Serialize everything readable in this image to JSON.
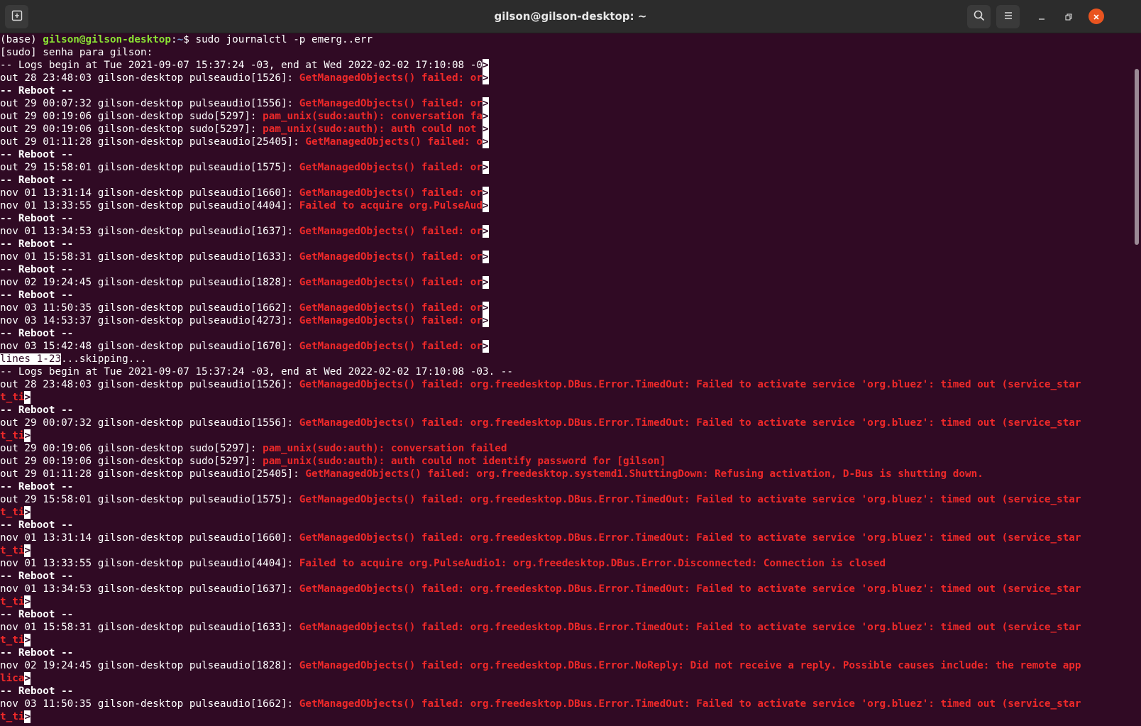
{
  "window": {
    "title": "gilson@gilson-desktop: ~",
    "icons": {
      "new_tab": "new-tab-icon",
      "search": "search-icon",
      "menu": "hamburger-menu-icon",
      "minimize": "minimize-icon",
      "maximize": "maximize-icon",
      "close": "close-icon"
    },
    "colors": {
      "background": "#300a24",
      "error": "#ef2929",
      "user": "#8ae234",
      "dir": "#729fcf",
      "close": "#e95420"
    }
  },
  "prompt": {
    "env": "(base) ",
    "user_host": "gilson@gilson-desktop",
    "sep": ":",
    "dir": "~",
    "symbol": "$ ",
    "command": "sudo journalctl -p emerg..err"
  },
  "lines": [
    {
      "t": "plain",
      "text": "[sudo] senha para gilson:"
    },
    {
      "t": "plain",
      "text": "-- Logs begin at Tue 2021-09-07 15:37:24 -03, end at Wed 2022-02-02 17:10:08 -0",
      "trunc": ">"
    },
    {
      "t": "log",
      "prefix": "out 28 23:48:03 gilson-desktop pulseaudio[1526]: ",
      "msg": "GetManagedObjects() failed: or",
      "trunc": ">"
    },
    {
      "t": "reboot",
      "text": "-- Reboot --"
    },
    {
      "t": "log",
      "prefix": "out 29 00:07:32 gilson-desktop pulseaudio[1556]: ",
      "msg": "GetManagedObjects() failed: or",
      "trunc": ">"
    },
    {
      "t": "log",
      "prefix": "out 29 00:19:06 gilson-desktop sudo[5297]: ",
      "msg": "pam_unix(sudo:auth): conversation fa",
      "trunc": ">"
    },
    {
      "t": "log",
      "prefix": "out 29 00:19:06 gilson-desktop sudo[5297]: ",
      "msg": "pam_unix(sudo:auth): auth could not ",
      "trunc": ">"
    },
    {
      "t": "log",
      "prefix": "out 29 01:11:28 gilson-desktop pulseaudio[25405]: ",
      "msg": "GetManagedObjects() failed: o",
      "trunc": ">"
    },
    {
      "t": "reboot",
      "text": "-- Reboot --"
    },
    {
      "t": "log",
      "prefix": "out 29 15:58:01 gilson-desktop pulseaudio[1575]: ",
      "msg": "GetManagedObjects() failed: or",
      "trunc": ">"
    },
    {
      "t": "reboot",
      "text": "-- Reboot --"
    },
    {
      "t": "log",
      "prefix": "nov 01 13:31:14 gilson-desktop pulseaudio[1660]: ",
      "msg": "GetManagedObjects() failed: or",
      "trunc": ">"
    },
    {
      "t": "log",
      "prefix": "nov 01 13:33:55 gilson-desktop pulseaudio[4404]: ",
      "msg": "Failed to acquire org.PulseAud",
      "trunc": ">"
    },
    {
      "t": "reboot",
      "text": "-- Reboot --"
    },
    {
      "t": "log",
      "prefix": "nov 01 13:34:53 gilson-desktop pulseaudio[1637]: ",
      "msg": "GetManagedObjects() failed: or",
      "trunc": ">"
    },
    {
      "t": "reboot",
      "text": "-- Reboot --"
    },
    {
      "t": "log",
      "prefix": "nov 01 15:58:31 gilson-desktop pulseaudio[1633]: ",
      "msg": "GetManagedObjects() failed: or",
      "trunc": ">"
    },
    {
      "t": "reboot",
      "text": "-- Reboot --"
    },
    {
      "t": "log",
      "prefix": "nov 02 19:24:45 gilson-desktop pulseaudio[1828]: ",
      "msg": "GetManagedObjects() failed: or",
      "trunc": ">"
    },
    {
      "t": "reboot",
      "text": "-- Reboot --"
    },
    {
      "t": "log",
      "prefix": "nov 03 11:50:35 gilson-desktop pulseaudio[1662]: ",
      "msg": "GetManagedObjects() failed: or",
      "trunc": ">"
    },
    {
      "t": "log",
      "prefix": "nov 03 14:53:37 gilson-desktop pulseaudio[4273]: ",
      "msg": "GetManagedObjects() failed: or",
      "trunc": ">"
    },
    {
      "t": "reboot",
      "text": "-- Reboot --"
    },
    {
      "t": "log",
      "prefix": "nov 03 15:42:48 gilson-desktop pulseaudio[1670]: ",
      "msg": "GetManagedObjects() failed: or",
      "trunc": ">"
    },
    {
      "t": "status",
      "highlight": "lines 1-23",
      "text": "...skipping..."
    },
    {
      "t": "plain",
      "text": "-- Logs begin at Tue 2021-09-07 15:37:24 -03, end at Wed 2022-02-02 17:10:08 -03. --"
    },
    {
      "t": "log",
      "prefix": "out 28 23:48:03 gilson-desktop pulseaudio[1526]: ",
      "msg": "GetManagedObjects() failed: org.freedesktop.DBus.Error.TimedOut: Failed to activate service 'org.bluez': timed out (service_star"
    },
    {
      "t": "cont",
      "msg": "t_ti",
      "trunc": ">"
    },
    {
      "t": "reboot",
      "text": "-- Reboot --"
    },
    {
      "t": "log",
      "prefix": "out 29 00:07:32 gilson-desktop pulseaudio[1556]: ",
      "msg": "GetManagedObjects() failed: org.freedesktop.DBus.Error.TimedOut: Failed to activate service 'org.bluez': timed out (service_star"
    },
    {
      "t": "cont",
      "msg": "t_ti",
      "trunc": ">"
    },
    {
      "t": "log",
      "prefix": "out 29 00:19:06 gilson-desktop sudo[5297]: ",
      "msg": "pam_unix(sudo:auth): conversation failed"
    },
    {
      "t": "log",
      "prefix": "out 29 00:19:06 gilson-desktop sudo[5297]: ",
      "msg": "pam_unix(sudo:auth): auth could not identify password for [gilson]"
    },
    {
      "t": "log",
      "prefix": "out 29 01:11:28 gilson-desktop pulseaudio[25405]: ",
      "msg": "GetManagedObjects() failed: org.freedesktop.systemd1.ShuttingDown: Refusing activation, D-Bus is shutting down."
    },
    {
      "t": "reboot",
      "text": "-- Reboot --"
    },
    {
      "t": "log",
      "prefix": "out 29 15:58:01 gilson-desktop pulseaudio[1575]: ",
      "msg": "GetManagedObjects() failed: org.freedesktop.DBus.Error.TimedOut: Failed to activate service 'org.bluez': timed out (service_star"
    },
    {
      "t": "cont",
      "msg": "t_ti",
      "trunc": ">"
    },
    {
      "t": "reboot",
      "text": "-- Reboot --"
    },
    {
      "t": "log",
      "prefix": "nov 01 13:31:14 gilson-desktop pulseaudio[1660]: ",
      "msg": "GetManagedObjects() failed: org.freedesktop.DBus.Error.TimedOut: Failed to activate service 'org.bluez': timed out (service_star"
    },
    {
      "t": "cont",
      "msg": "t_ti",
      "trunc": ">"
    },
    {
      "t": "log",
      "prefix": "nov 01 13:33:55 gilson-desktop pulseaudio[4404]: ",
      "msg": "Failed to acquire org.PulseAudio1: org.freedesktop.DBus.Error.Disconnected: Connection is closed"
    },
    {
      "t": "reboot",
      "text": "-- Reboot --"
    },
    {
      "t": "log",
      "prefix": "nov 01 13:34:53 gilson-desktop pulseaudio[1637]: ",
      "msg": "GetManagedObjects() failed: org.freedesktop.DBus.Error.TimedOut: Failed to activate service 'org.bluez': timed out (service_star"
    },
    {
      "t": "cont",
      "msg": "t_ti",
      "trunc": ">"
    },
    {
      "t": "reboot",
      "text": "-- Reboot --"
    },
    {
      "t": "log",
      "prefix": "nov 01 15:58:31 gilson-desktop pulseaudio[1633]: ",
      "msg": "GetManagedObjects() failed: org.freedesktop.DBus.Error.TimedOut: Failed to activate service 'org.bluez': timed out (service_star"
    },
    {
      "t": "cont",
      "msg": "t_ti",
      "trunc": ">"
    },
    {
      "t": "reboot",
      "text": "-- Reboot --"
    },
    {
      "t": "log",
      "prefix": "nov 02 19:24:45 gilson-desktop pulseaudio[1828]: ",
      "msg": "GetManagedObjects() failed: org.freedesktop.DBus.Error.NoReply: Did not receive a reply. Possible causes include: the remote app"
    },
    {
      "t": "cont",
      "msg": "lica",
      "trunc": ">"
    },
    {
      "t": "reboot",
      "text": "-- Reboot --"
    },
    {
      "t": "log",
      "prefix": "nov 03 11:50:35 gilson-desktop pulseaudio[1662]: ",
      "msg": "GetManagedObjects() failed: org.freedesktop.DBus.Error.TimedOut: Failed to activate service 'org.bluez': timed out (service_star"
    },
    {
      "t": "cont",
      "msg": "t_ti",
      "trunc": ">"
    }
  ]
}
